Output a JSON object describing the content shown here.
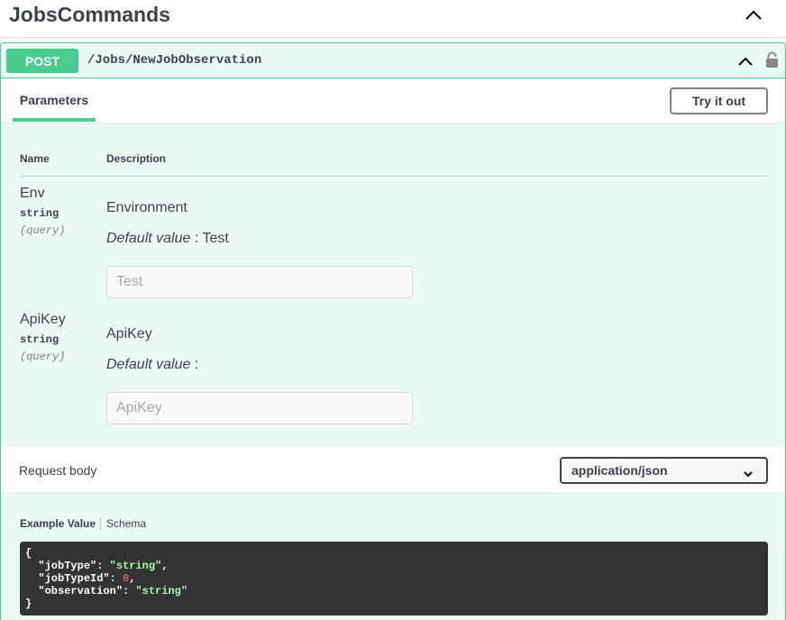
{
  "tag": {
    "title": "JobsCommands"
  },
  "operation": {
    "method": "POST",
    "path": "/Jobs/NewJobObservation",
    "color": "#49cc90"
  },
  "tabs": {
    "parameters": "Parameters",
    "try_it_out": "Try it out"
  },
  "columns": {
    "name": "Name",
    "description": "Description"
  },
  "params": [
    {
      "name": "Env",
      "type": "string",
      "in": "(query)",
      "description": "Environment",
      "default_label": "Default value",
      "default_sep": ":",
      "default_value": "Test",
      "placeholder": "Test"
    },
    {
      "name": "ApiKey",
      "type": "string",
      "in": "(query)",
      "description": "ApiKey",
      "default_label": "Default value",
      "default_sep": ":",
      "default_value": "",
      "placeholder": "ApiKey"
    }
  ],
  "request_body": {
    "label": "Request body",
    "content_type": "application/json"
  },
  "example": {
    "active_tab": "Example Value",
    "other_tab": "Schema",
    "open_brace": "{",
    "close_brace": "}",
    "fields": [
      {
        "key": "\"jobType\"",
        "value": "\"string\"",
        "kind": "str",
        "trail": ","
      },
      {
        "key": "\"jobTypeId\"",
        "value": "0",
        "kind": "num",
        "trail": ","
      },
      {
        "key": "\"observation\"",
        "value": "\"string\"",
        "kind": "str",
        "trail": ""
      }
    ]
  },
  "icons": {
    "tag_collapse": "chevron-up-icon",
    "summary_collapse": "chevron-up-icon",
    "lock": "lock-icon",
    "select": "chevron-down-icon"
  }
}
